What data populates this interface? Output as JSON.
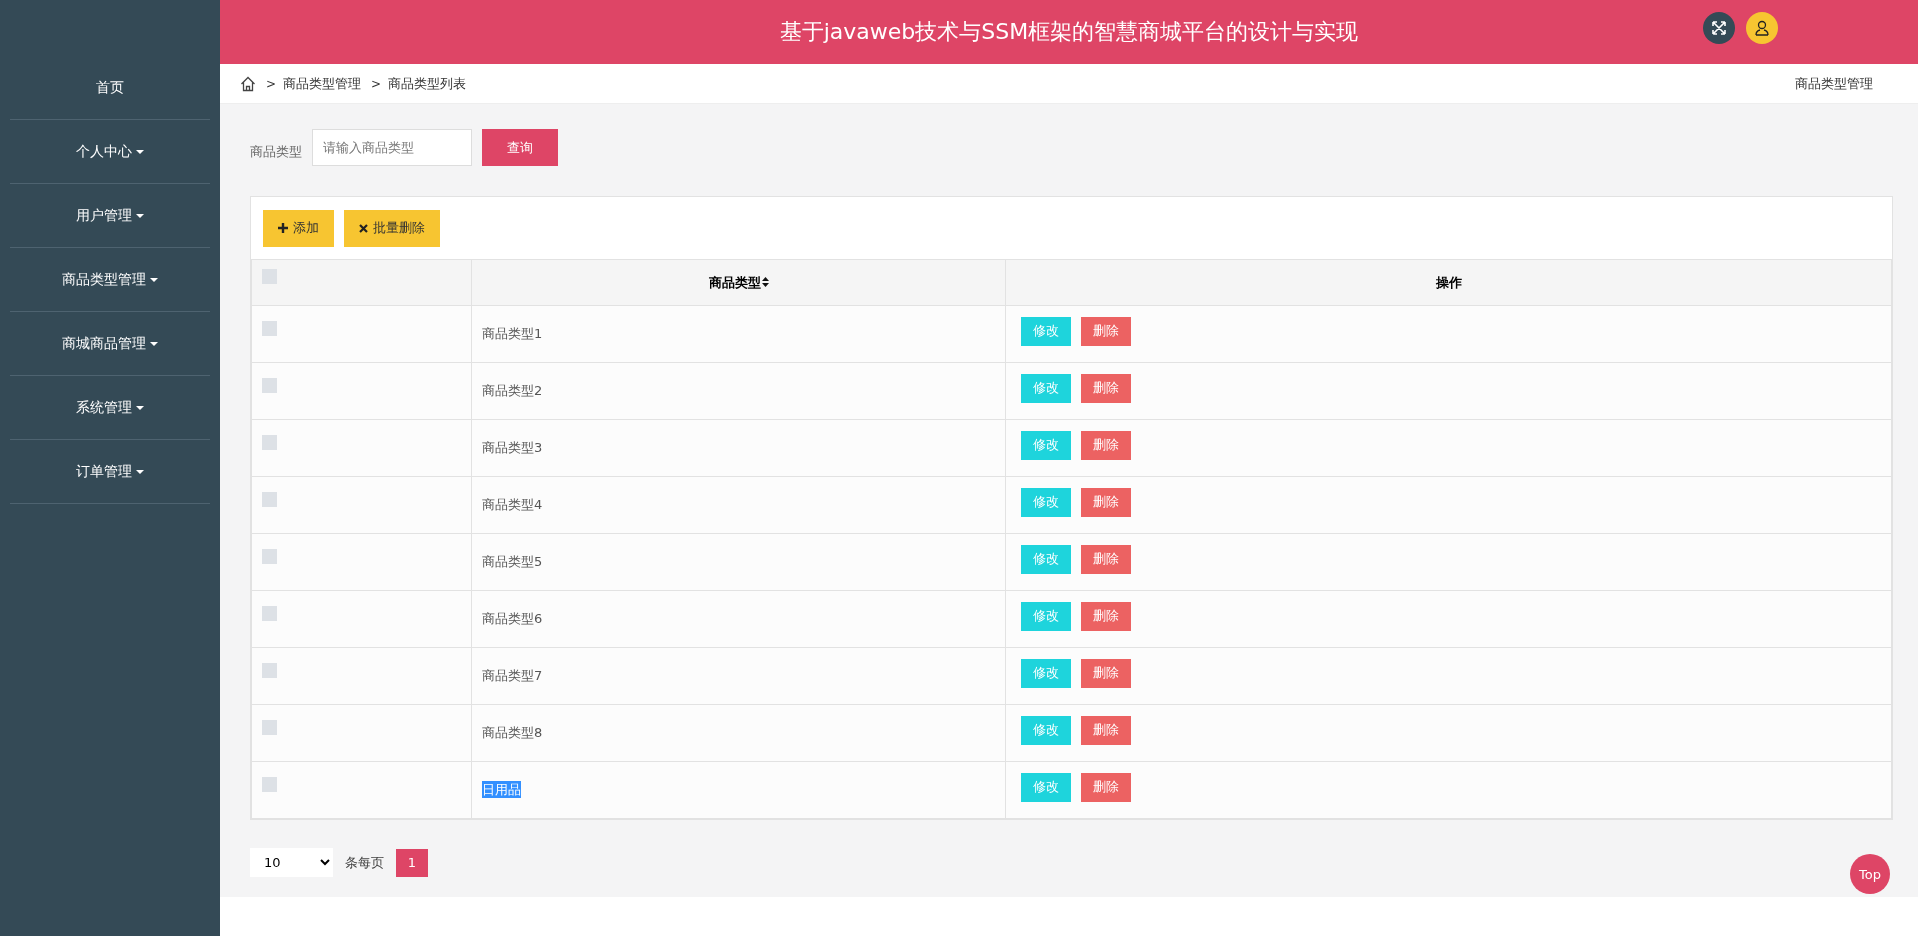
{
  "header": {
    "title": "基于javaweb技术与SSM框架的智慧商城平台的设计与实现"
  },
  "sidebar": {
    "items": [
      {
        "label": "首页",
        "kind": "link"
      },
      {
        "label": "个人中心",
        "kind": "menu",
        "expanded": false
      },
      {
        "label": "用户管理",
        "kind": "menu",
        "expanded": false
      },
      {
        "label": "商品类型管理",
        "kind": "menu",
        "expanded": false
      },
      {
        "label": "商城商品管理",
        "kind": "menu",
        "expanded": false
      },
      {
        "label": "系统管理",
        "kind": "menu",
        "expanded": false
      },
      {
        "label": "订单管理",
        "kind": "menu",
        "expanded": false
      }
    ]
  },
  "breadcrumb": {
    "items": [
      {
        "separator": ">",
        "label": "商品类型管理"
      },
      {
        "separator": ">",
        "label": "商品类型列表"
      }
    ],
    "page_title": "商品类型管理"
  },
  "search": {
    "label": "商品类型",
    "placeholder": "请输入商品类型",
    "button": "查询"
  },
  "toolbar": [
    {
      "label": "添加",
      "kind": "add"
    },
    {
      "label": "批量删除",
      "kind": "delete"
    }
  ],
  "table": {
    "header_checked": false,
    "columns": [
      "商品类型",
      "操作"
    ],
    "rows": [
      {
        "name": "商品类型1",
        "checked": false,
        "selected": false,
        "actions": [
          "修改",
          "删除"
        ]
      },
      {
        "name": "商品类型2",
        "checked": false,
        "selected": false,
        "actions": [
          "修改",
          "删除"
        ]
      },
      {
        "name": "商品类型3",
        "checked": false,
        "selected": false,
        "actions": [
          "修改",
          "删除"
        ]
      },
      {
        "name": "商品类型4",
        "checked": false,
        "selected": false,
        "actions": [
          "修改",
          "删除"
        ]
      },
      {
        "name": "商品类型5",
        "checked": false,
        "selected": false,
        "actions": [
          "修改",
          "删除"
        ]
      },
      {
        "name": "商品类型6",
        "checked": false,
        "selected": false,
        "actions": [
          "修改",
          "删除"
        ]
      },
      {
        "name": "商品类型7",
        "checked": false,
        "selected": false,
        "actions": [
          "修改",
          "删除"
        ]
      },
      {
        "name": "商品类型8",
        "checked": false,
        "selected": false,
        "actions": [
          "修改",
          "删除"
        ]
      },
      {
        "name": "日用品",
        "checked": false,
        "selected": true,
        "actions": [
          "修改",
          "删除"
        ]
      }
    ]
  },
  "pagination": {
    "page_size": "10",
    "per_page_label": "条每页",
    "pages": [
      {
        "label": "1",
        "selected": true
      }
    ]
  },
  "top_button": "Top"
}
